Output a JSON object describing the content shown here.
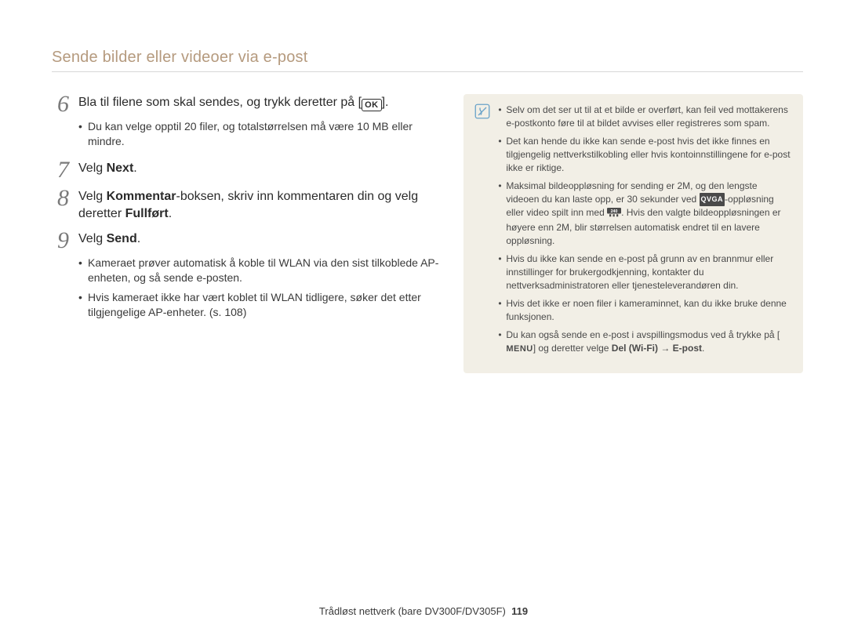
{
  "header": {
    "title": "Sende bilder eller videoer via e-post"
  },
  "steps": {
    "s6": {
      "num": "6",
      "text_before": "Bla til filene som skal sendes, og trykk deretter på [",
      "icon_label": "OK",
      "text_after": "].",
      "bullets": [
        "Du kan velge opptil 20 filer, og totalstørrelsen må være 10 MB eller mindre."
      ]
    },
    "s7": {
      "num": "7",
      "text": "Velg ",
      "bold": "Next",
      "after": "."
    },
    "s8": {
      "num": "8",
      "text_a": "Velg ",
      "bold_a": "Kommentar",
      "text_b": "-boksen, skriv inn kommentaren din og velg deretter ",
      "bold_b": "Fullført",
      "after": "."
    },
    "s9": {
      "num": "9",
      "text": "Velg ",
      "bold": "Send",
      "after": ".",
      "bullets": [
        "Kameraet prøver automatisk å koble til WLAN via den sist tilkoblede AP-enheten, og så sende e-posten.",
        "Hvis kameraet ikke har vært koblet til WLAN tidligere, søker det etter tilgjengelige AP-enheter. (s. 108)"
      ]
    }
  },
  "notes": {
    "items": [
      {
        "t": "Selv om det ser ut til at et bilde er overført, kan feil ved mottakerens e-postkonto føre til at bildet avvises eller registreres som spam."
      },
      {
        "t": "Det kan hende du ikke kan sende e-post hvis det ikke finnes en tilgjengelig nettverkstilkobling eller hvis kontoinnstillingene for e-post ikke er riktige."
      },
      {
        "qvga_pre": "Maksimal bildeoppløsning for sending er 2M, og den lengste videoen du kan laste opp, er 30 sekunder ved ",
        "qvga_label": "QVGA",
        "qvga_mid": "-oppløsning eller video spilt inn med ",
        "badge": "240",
        "qvga_post": ". Hvis den valgte bildeoppløsningen er høyere enn 2M, blir størrelsen automatisk endret til en lavere oppløsning."
      },
      {
        "t": "Hvis du ikke kan sende en e-post på grunn av en brannmur eller innstillinger for brukergodkjenning, kontakter du nettverksadministratoren eller tjenesteleverandøren din."
      },
      {
        "t": "Hvis det ikke er noen filer i kameraminnet, kan du ikke bruke denne funksjonen."
      },
      {
        "menu_pre": "Du kan også sende en e-post i avspillingsmodus ved å trykke på [",
        "menu_label": "MENU",
        "menu_mid": "] og deretter velge ",
        "menu_bold": "Del (Wi-Fi) → E-post",
        "menu_post": "."
      }
    ]
  },
  "footer": {
    "line": "Trådløst nettverk (bare DV300F/DV305F)",
    "page_no": "119"
  }
}
